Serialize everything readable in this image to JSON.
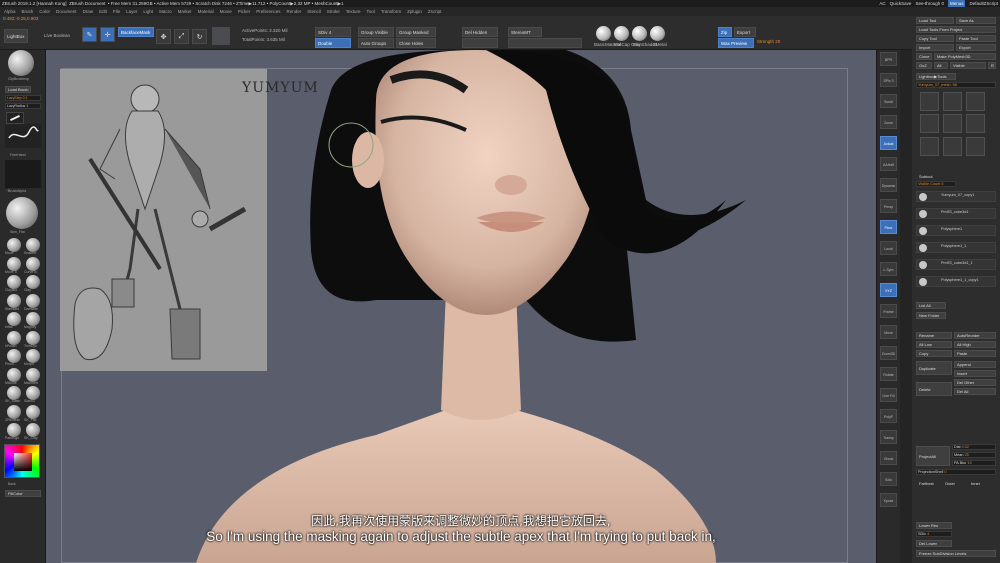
{
  "titlebar": {
    "app": "ZBrush 2019.1.2 [Hannah Kong]",
    "doc": "ZBrush Document",
    "stats": "• Free Mem 31.259GB • Active Mem 5729 • Scratch Disk 7246 • ZTime▶11.712 • PolyCount▶2.32 MP • MeshCount▶1",
    "ac": "AC",
    "quicksave": "QuickSave",
    "seethrough": "See-through 0",
    "menus": "Menus",
    "script": "DefaultZScript"
  },
  "menubar": [
    "Alpha",
    "Brush",
    "Color",
    "Document",
    "Draw",
    "Edit",
    "File",
    "Layer",
    "Light",
    "Macro",
    "Marker",
    "Material",
    "Movie",
    "Picker",
    "Preferences",
    "Render",
    "Stencil",
    "Stroke",
    "Texture",
    "Tool",
    "Transform",
    "Zplugin",
    "Zscript"
  ],
  "toolbar": {
    "lightbox": "LightBox",
    "livebool": "Live Boolean",
    "edit": "Edit",
    "draw": "Draw",
    "move": "Move",
    "scale": "Scale",
    "rotate": "Rotate",
    "backface": "BackfaceMask",
    "active_points": "ActivePoints: 2.320 Mil",
    "total_points": "TotalPoints: 3.635 Mil",
    "sdiv": "SDiv 4",
    "double": "Double",
    "group_visible": "Group Visible",
    "auto_groups": "Auto Groups",
    "group_masked": "Group Masked",
    "close_holes": "Close Holes",
    "del_hidden": "Del Hidden",
    "stereo": "StereoMT",
    "mat1": "BasicMaterial",
    "mat2": "MatCap Gray",
    "mat3": "SkinShade4",
    "mat4": "ZMetal",
    "zip": "Zip",
    "export": "Export",
    "wax": "Wax Preview",
    "strength": "Strength 28",
    "coords": "0.482,-0.25,0.903"
  },
  "leftshelf": {
    "clipbrush": "ClipBrushesp",
    "load_brush": "Load Brush",
    "lazystep": "LazyStep 0.1",
    "lazyradius": "LazyRadius 1",
    "freehand": "FreeHand",
    "brushalpha": "~BrushAlpha",
    "skin_flat": "Skin_Flat",
    "brushes": [
      "Move",
      "SnakeH",
      "Move Ti",
      "CurveTu",
      "ClayBui",
      "Clay",
      "Standard",
      "Damstan",
      "Inflat",
      "Magnify",
      "hPolish",
      "TrimDyn",
      "Pinch",
      "Morph",
      "MAInse",
      "MAInsert",
      "SK_Slash",
      "Slash3",
      "ZRemesh",
      "SK_Flat",
      "PaintSgh",
      "SK_Clay"
    ],
    "back": "Back",
    "fillcolor": "FillColor"
  },
  "canvas": {
    "ref_text": "YUMYUM"
  },
  "subtitles": {
    "cn": "因此,我再次使用蒙版来调整微妙的顶点,我想把它放回去,",
    "en": "So I'm using the masking again to adjust the subtle apex that I'm trying to put back in,"
  },
  "rightshelf": [
    "BPR",
    "SPix 3",
    "Scroll",
    "Zoom",
    "Actual",
    "AAHalf",
    "Dynamic",
    "Persp",
    "Floor",
    "Local",
    "L.Sym",
    "XYZ",
    "Frame",
    "Move",
    "Zoom3D",
    "Rotate",
    "Line Fill",
    "PolyF",
    "Transp",
    "Ghost",
    "Solo",
    "Xpose"
  ],
  "tray": {
    "load_tool": "Load Tool",
    "save_as": "Save As",
    "load_tools_project": "Load Tools From Project",
    "copy_tool": "Copy Tool",
    "paste_tool": "Paste Tool",
    "import": "Import",
    "export": "Export",
    "clone": "Clone",
    "make_polymesh": "Make PolyMesh3D",
    "goz": "GoZ",
    "all": "All",
    "visible": "Visible",
    "r": "R",
    "lightbox_tools": "Lightbox▶Tools",
    "current_tool": "Yumyum_07_mesh. 56",
    "subtool_header": "Subtool",
    "visible_count": "Visible Count 5",
    "subtools": [
      "Yumyum_07_copy1",
      "PmSS_cube3d1",
      "Polysphere1",
      "Polysphere1_1",
      "PmSS_cube3d1_1",
      "Polysphere1_1_copy1"
    ],
    "list_all": "List All",
    "new_folder": "New Folder",
    "rename": "Rename",
    "autoreorder": "AutoReorder",
    "all_low": "All Low",
    "all_high": "All High",
    "copy": "Copy",
    "paste": "Paste",
    "append": "Append",
    "duplicate": "Duplicate",
    "insert": "Insert",
    "delete": "Delete",
    "del_other": "Del Other",
    "del_all": "Del All",
    "project_all": "ProjectAll",
    "dist": "Dist",
    "dist_val": "0.02",
    "mean": "Mean",
    "mean_val": "25",
    "pa_blur": "PA Blur",
    "pa_blur_val": "10",
    "projection_shell": "ProjectionShell",
    "projection_shell_val": "0",
    "farthest": "Farthest",
    "outer": "Outer",
    "inner": "Inner",
    "lower_res": "Lower Res",
    "sdiv": "SDiv",
    "sdiv_val": "4",
    "del_lower": "Del Lower",
    "freeze_sub": "Freeze SubDivision Levels"
  },
  "colors": {
    "accent": "#3b6fb8",
    "orange": "#e08a2b",
    "canvas_bg": "#5a5d6b",
    "panel": "#2d2d2d"
  }
}
